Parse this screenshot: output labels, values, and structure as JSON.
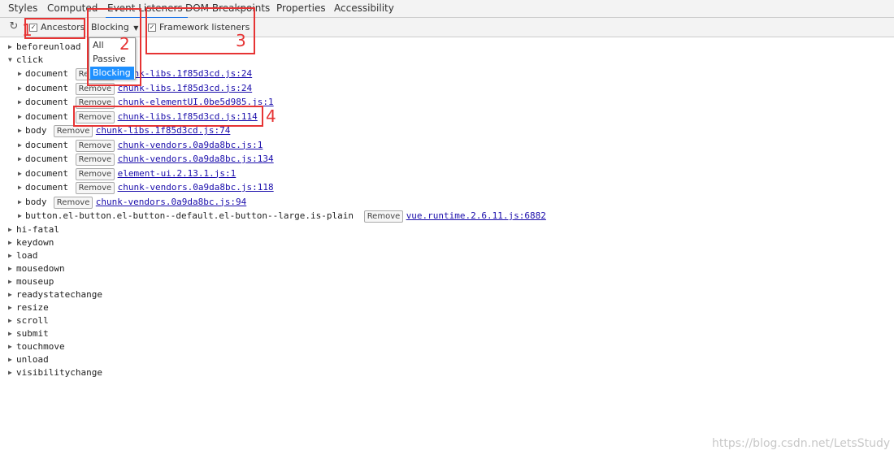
{
  "tabs": [
    {
      "label": "Styles",
      "active": false
    },
    {
      "label": "Computed",
      "active": false
    },
    {
      "label": "Event Listeners",
      "active": true
    },
    {
      "label": "DOM Breakpoints",
      "active": false
    },
    {
      "label": "Properties",
      "active": false
    },
    {
      "label": "Accessibility",
      "active": false
    }
  ],
  "toolbar": {
    "refresh_icon": "refresh-icon",
    "ancestors_label": "Ancestors",
    "ancestors_checked": true,
    "dispatch_selected": "Blocking",
    "dispatch_options": [
      "All",
      "Passive",
      "Blocking"
    ],
    "framework_label": "Framework listeners",
    "framework_checked": true
  },
  "remove_label": "Remove",
  "listeners": [
    {
      "event": "beforeunload",
      "expanded": false
    },
    {
      "event": "click",
      "expanded": true,
      "entries": [
        {
          "node": "document",
          "source": "chunk-libs.1f85d3cd.js:24"
        },
        {
          "node": "document",
          "source": "chunk-libs.1f85d3cd.js:24"
        },
        {
          "node": "document",
          "source": "chunk-elementUI.0be5d985.js:1"
        },
        {
          "node": "document",
          "source": "chunk-libs.1f85d3cd.js:114"
        },
        {
          "node": "body",
          "source": "chunk-libs.1f85d3cd.js:74"
        },
        {
          "node": "document",
          "source": "chunk-vendors.0a9da8bc.js:1"
        },
        {
          "node": "document",
          "source": "chunk-vendors.0a9da8bc.js:134"
        },
        {
          "node": "document",
          "source": "element-ui.2.13.1.js:1"
        },
        {
          "node": "document",
          "source": "chunk-vendors.0a9da8bc.js:118"
        },
        {
          "node": "body",
          "source": "chunk-vendors.0a9da8bc.js:94"
        },
        {
          "node": "button.el-button.el-button--default.el-button--large.is-plain",
          "source": "vue.runtime.2.6.11.js:6882"
        }
      ]
    },
    {
      "event": "hi-fatal",
      "expanded": false
    },
    {
      "event": "keydown",
      "expanded": false
    },
    {
      "event": "load",
      "expanded": false
    },
    {
      "event": "mousedown",
      "expanded": false
    },
    {
      "event": "mouseup",
      "expanded": false
    },
    {
      "event": "readystatechange",
      "expanded": false
    },
    {
      "event": "resize",
      "expanded": false
    },
    {
      "event": "scroll",
      "expanded": false
    },
    {
      "event": "submit",
      "expanded": false
    },
    {
      "event": "touchmove",
      "expanded": false
    },
    {
      "event": "unload",
      "expanded": false
    },
    {
      "event": "visibilitychange",
      "expanded": false
    }
  ],
  "annotations": [
    "1",
    "2",
    "3",
    "4"
  ],
  "watermark": "https://blog.csdn.net/LetsStudy",
  "colors": {
    "annotation": "#e63333",
    "link": "#1a0dab",
    "selected_option": "#1e90ff",
    "active_tab": "#1a73e8"
  }
}
